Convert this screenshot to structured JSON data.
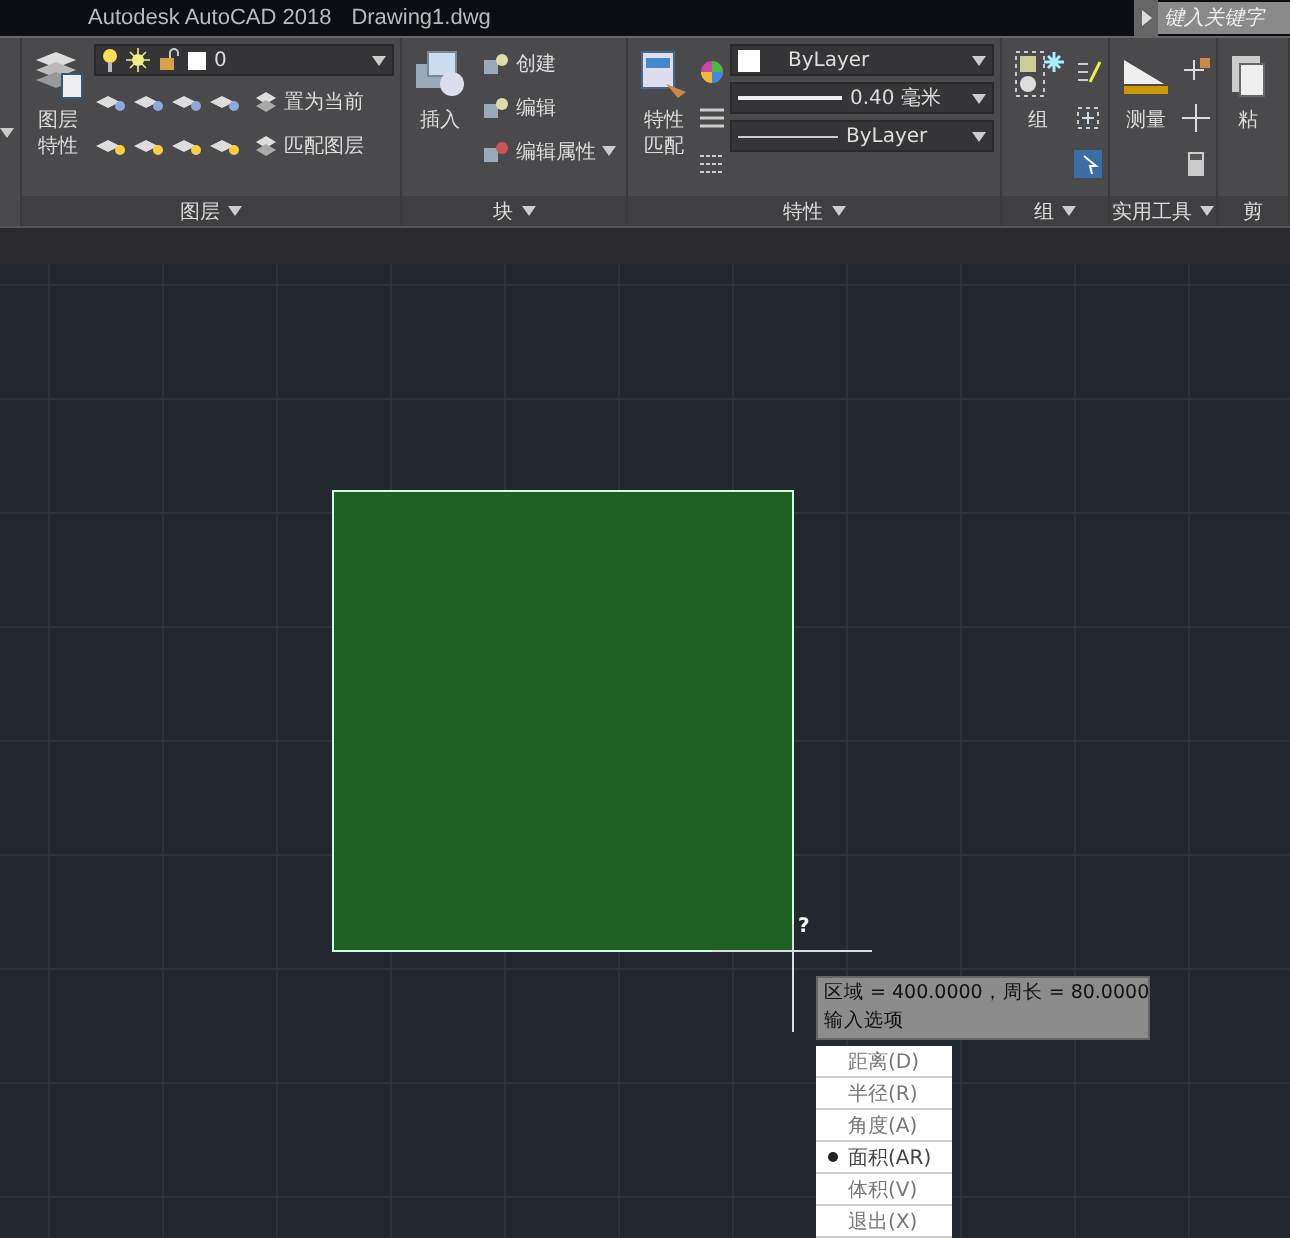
{
  "title_bar": {
    "app_title": "Autodesk AutoCAD 2018",
    "file_name": "Drawing1.dwg",
    "search_placeholder": "键入关键字"
  },
  "ribbon": {
    "panels": [
      {
        "kind": "layers",
        "title": "图层",
        "large_button": [
          "图层",
          "特性"
        ],
        "layer_dropdown": "0",
        "buttons": [
          "置为当前",
          "匹配图层"
        ]
      },
      {
        "kind": "block",
        "title": "块",
        "large_button": [
          "插入"
        ],
        "buttons": [
          "创建",
          "编辑",
          "编辑属性"
        ]
      },
      {
        "kind": "properties",
        "title": "特性",
        "large_button": [
          "特性",
          "匹配"
        ],
        "color_setting": "ByLayer",
        "lineweight": "0.40 毫米",
        "linetype": "ByLayer"
      },
      {
        "kind": "group",
        "title": "组",
        "large_button": [
          "组"
        ]
      },
      {
        "kind": "utilities",
        "title": "实用工具",
        "large_button": [
          "测量"
        ]
      },
      {
        "kind": "clipboard",
        "title": "剪",
        "large_button": [
          "粘"
        ]
      }
    ]
  },
  "canvas": {
    "cursor_prompt": "?",
    "tooltip": {
      "line_1": "区域 = 400.0000，周长 = 80.0000",
      "line_2": "输入选项"
    },
    "options": [
      {
        "label": "距离(D)",
        "selected": false
      },
      {
        "label": "半径(R)",
        "selected": false
      },
      {
        "label": "角度(A)",
        "selected": false
      },
      {
        "label": "面积(AR)",
        "selected": true
      },
      {
        "label": "体积(V)",
        "selected": false
      },
      {
        "label": "退出(X)",
        "selected": false
      }
    ]
  }
}
